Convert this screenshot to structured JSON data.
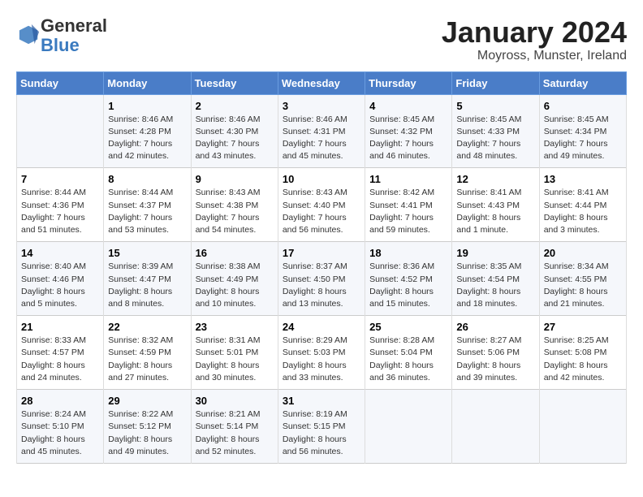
{
  "header": {
    "logo_general": "General",
    "logo_blue": "Blue",
    "month_title": "January 2024",
    "subtitle": "Moyross, Munster, Ireland"
  },
  "calendar": {
    "days_of_week": [
      "Sunday",
      "Monday",
      "Tuesday",
      "Wednesday",
      "Thursday",
      "Friday",
      "Saturday"
    ],
    "weeks": [
      [
        {
          "day": "",
          "info": ""
        },
        {
          "day": "1",
          "info": "Sunrise: 8:46 AM\nSunset: 4:28 PM\nDaylight: 7 hours\nand 42 minutes."
        },
        {
          "day": "2",
          "info": "Sunrise: 8:46 AM\nSunset: 4:30 PM\nDaylight: 7 hours\nand 43 minutes."
        },
        {
          "day": "3",
          "info": "Sunrise: 8:46 AM\nSunset: 4:31 PM\nDaylight: 7 hours\nand 45 minutes."
        },
        {
          "day": "4",
          "info": "Sunrise: 8:45 AM\nSunset: 4:32 PM\nDaylight: 7 hours\nand 46 minutes."
        },
        {
          "day": "5",
          "info": "Sunrise: 8:45 AM\nSunset: 4:33 PM\nDaylight: 7 hours\nand 48 minutes."
        },
        {
          "day": "6",
          "info": "Sunrise: 8:45 AM\nSunset: 4:34 PM\nDaylight: 7 hours\nand 49 minutes."
        }
      ],
      [
        {
          "day": "7",
          "info": "Sunrise: 8:44 AM\nSunset: 4:36 PM\nDaylight: 7 hours\nand 51 minutes."
        },
        {
          "day": "8",
          "info": "Sunrise: 8:44 AM\nSunset: 4:37 PM\nDaylight: 7 hours\nand 53 minutes."
        },
        {
          "day": "9",
          "info": "Sunrise: 8:43 AM\nSunset: 4:38 PM\nDaylight: 7 hours\nand 54 minutes."
        },
        {
          "day": "10",
          "info": "Sunrise: 8:43 AM\nSunset: 4:40 PM\nDaylight: 7 hours\nand 56 minutes."
        },
        {
          "day": "11",
          "info": "Sunrise: 8:42 AM\nSunset: 4:41 PM\nDaylight: 7 hours\nand 59 minutes."
        },
        {
          "day": "12",
          "info": "Sunrise: 8:41 AM\nSunset: 4:43 PM\nDaylight: 8 hours\nand 1 minute."
        },
        {
          "day": "13",
          "info": "Sunrise: 8:41 AM\nSunset: 4:44 PM\nDaylight: 8 hours\nand 3 minutes."
        }
      ],
      [
        {
          "day": "14",
          "info": "Sunrise: 8:40 AM\nSunset: 4:46 PM\nDaylight: 8 hours\nand 5 minutes."
        },
        {
          "day": "15",
          "info": "Sunrise: 8:39 AM\nSunset: 4:47 PM\nDaylight: 8 hours\nand 8 minutes."
        },
        {
          "day": "16",
          "info": "Sunrise: 8:38 AM\nSunset: 4:49 PM\nDaylight: 8 hours\nand 10 minutes."
        },
        {
          "day": "17",
          "info": "Sunrise: 8:37 AM\nSunset: 4:50 PM\nDaylight: 8 hours\nand 13 minutes."
        },
        {
          "day": "18",
          "info": "Sunrise: 8:36 AM\nSunset: 4:52 PM\nDaylight: 8 hours\nand 15 minutes."
        },
        {
          "day": "19",
          "info": "Sunrise: 8:35 AM\nSunset: 4:54 PM\nDaylight: 8 hours\nand 18 minutes."
        },
        {
          "day": "20",
          "info": "Sunrise: 8:34 AM\nSunset: 4:55 PM\nDaylight: 8 hours\nand 21 minutes."
        }
      ],
      [
        {
          "day": "21",
          "info": "Sunrise: 8:33 AM\nSunset: 4:57 PM\nDaylight: 8 hours\nand 24 minutes."
        },
        {
          "day": "22",
          "info": "Sunrise: 8:32 AM\nSunset: 4:59 PM\nDaylight: 8 hours\nand 27 minutes."
        },
        {
          "day": "23",
          "info": "Sunrise: 8:31 AM\nSunset: 5:01 PM\nDaylight: 8 hours\nand 30 minutes."
        },
        {
          "day": "24",
          "info": "Sunrise: 8:29 AM\nSunset: 5:03 PM\nDaylight: 8 hours\nand 33 minutes."
        },
        {
          "day": "25",
          "info": "Sunrise: 8:28 AM\nSunset: 5:04 PM\nDaylight: 8 hours\nand 36 minutes."
        },
        {
          "day": "26",
          "info": "Sunrise: 8:27 AM\nSunset: 5:06 PM\nDaylight: 8 hours\nand 39 minutes."
        },
        {
          "day": "27",
          "info": "Sunrise: 8:25 AM\nSunset: 5:08 PM\nDaylight: 8 hours\nand 42 minutes."
        }
      ],
      [
        {
          "day": "28",
          "info": "Sunrise: 8:24 AM\nSunset: 5:10 PM\nDaylight: 8 hours\nand 45 minutes."
        },
        {
          "day": "29",
          "info": "Sunrise: 8:22 AM\nSunset: 5:12 PM\nDaylight: 8 hours\nand 49 minutes."
        },
        {
          "day": "30",
          "info": "Sunrise: 8:21 AM\nSunset: 5:14 PM\nDaylight: 8 hours\nand 52 minutes."
        },
        {
          "day": "31",
          "info": "Sunrise: 8:19 AM\nSunset: 5:15 PM\nDaylight: 8 hours\nand 56 minutes."
        },
        {
          "day": "",
          "info": ""
        },
        {
          "day": "",
          "info": ""
        },
        {
          "day": "",
          "info": ""
        }
      ]
    ]
  }
}
